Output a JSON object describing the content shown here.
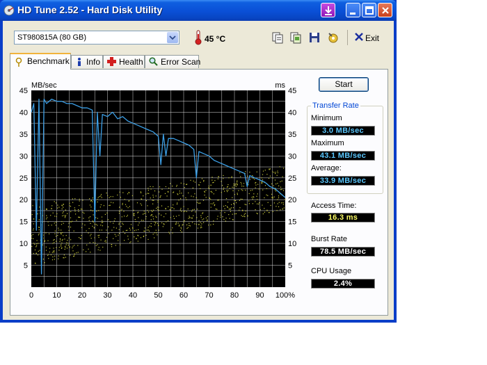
{
  "window": {
    "title": "HD Tune 2.52 - Hard Disk Utility"
  },
  "toolbar": {
    "drive": "ST980815A (80 GB)",
    "temperature": "45 °C",
    "exit_label": "Exit"
  },
  "tabs": [
    {
      "label": "Benchmark",
      "active": true,
      "icon": "benchmark-icon"
    },
    {
      "label": "Info",
      "active": false,
      "icon": "info-icon"
    },
    {
      "label": "Health",
      "active": false,
      "icon": "health-cross-icon"
    },
    {
      "label": "Error Scan",
      "active": false,
      "icon": "magnifier-icon"
    }
  ],
  "benchmark": {
    "start_label": "Start",
    "transfer_rate_title": "Transfer Rate",
    "minimum_label": "Minimum",
    "minimum_value": "3.0 MB/sec",
    "maximum_label": "Maximum",
    "maximum_value": "43.1 MB/sec",
    "average_label": "Average:",
    "average_value": "33.9 MB/sec",
    "access_time_label": "Access Time:",
    "access_time_value": "16.3 ms",
    "burst_rate_label": "Burst Rate",
    "burst_rate_value": "78.5 MB/sec",
    "cpu_label": "CPU Usage",
    "cpu_value": "2.4%"
  },
  "colors": {
    "chart_bg": "#000000",
    "grid": "#d9d9d9",
    "transfer_line": "#3c9fe6",
    "access_dots": "#c8c83a",
    "readout_blue": "#5bc8ff",
    "readout_yellow": "#ffff66",
    "readout_white": "#ffffff"
  },
  "chart_data": {
    "type": "line",
    "left_axis_unit": "MB/sec",
    "right_axis_unit": "ms",
    "ylim": [
      0,
      45
    ],
    "xlim": [
      0,
      100
    ],
    "y_ticks": [
      5,
      10,
      15,
      20,
      25,
      30,
      35,
      40,
      45
    ],
    "x_ticks": [
      "0",
      "10",
      "20",
      "30",
      "40",
      "50",
      "60",
      "70",
      "80",
      "90",
      "100%"
    ],
    "grid": true,
    "transfer_rate_mbps": {
      "x": [
        0,
        1,
        2,
        3,
        4,
        5,
        6,
        8,
        10,
        12,
        14,
        16,
        18,
        20,
        22,
        24,
        25,
        26,
        27,
        28,
        30,
        32,
        34,
        36,
        38,
        40,
        42,
        44,
        46,
        48,
        50,
        51,
        52,
        53,
        54,
        56,
        58,
        60,
        62,
        64,
        65,
        66,
        68,
        70,
        72,
        74,
        76,
        78,
        80,
        82,
        84,
        85,
        86,
        88,
        90,
        92,
        94,
        96,
        98,
        100
      ],
      "y": [
        40,
        42,
        13,
        43,
        3,
        43,
        42,
        43,
        42.5,
        42.5,
        42,
        42,
        41.5,
        41,
        41,
        40.5,
        15,
        40,
        30,
        39.5,
        39,
        40,
        38.5,
        39,
        38,
        37.5,
        37,
        36.5,
        36,
        35.5,
        34.5,
        28,
        35,
        30,
        34,
        34,
        33.5,
        33,
        32.5,
        31.5,
        25,
        31,
        30.5,
        30,
        29,
        28.5,
        28,
        27.5,
        27,
        26.5,
        26,
        23,
        25.5,
        25,
        24.5,
        24,
        23,
        22.5,
        21.5,
        20.5
      ]
    },
    "access_time_ms": {
      "description_points": "scatter of random seek times, approx 5–28 ms spread rising from left to right",
      "min_band_start": 5,
      "max_band_start": 19,
      "min_band_end": 18,
      "max_band_end": 28
    }
  }
}
